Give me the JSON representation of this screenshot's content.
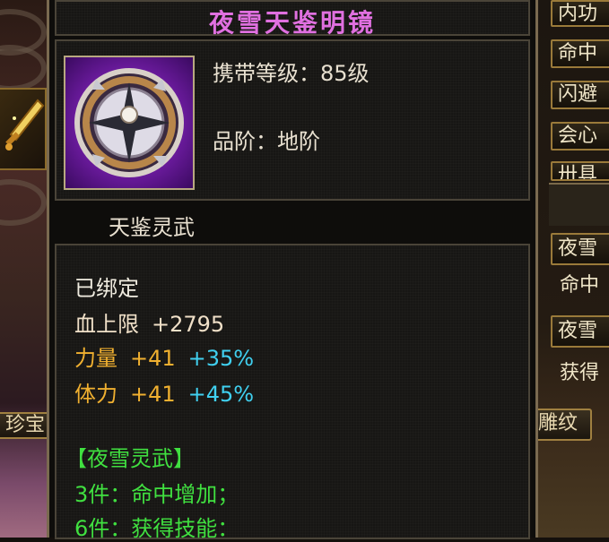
{
  "item": {
    "name": "夜雪天鉴明镜",
    "carry_level": "携带等级：85级",
    "grade": "品阶：地阶",
    "series": "天鉴灵武",
    "icon": "silver-mirror-shield-icon"
  },
  "stats": {
    "bound": "已绑定",
    "hp_label": "血上限",
    "hp_value": "+2795",
    "str_label": "力量",
    "str_value": "+41",
    "str_pct": "+35%",
    "con_label": "体力",
    "con_value": "+41",
    "con_pct": "+45%"
  },
  "set": {
    "name": "【夜雪灵武】",
    "bonus_3": "3件：命中增加；",
    "bonus_6": "6件：获得技能："
  },
  "side_left": {
    "tab_label": "珍宝"
  },
  "side_right": {
    "attr_1": "内功",
    "attr_2": "命中",
    "attr_3": "闪避",
    "attr_4": "会心",
    "attr_5": "卅具",
    "set_btn_1": "夜雪",
    "row_1": "命中",
    "set_btn_2": "夜雪",
    "row_2": "获得",
    "tab_label": "雕纹"
  },
  "colors": {
    "title": "#e070e0",
    "gold": "#f0b030",
    "cyan": "#40d0f0",
    "green": "#40e040"
  }
}
